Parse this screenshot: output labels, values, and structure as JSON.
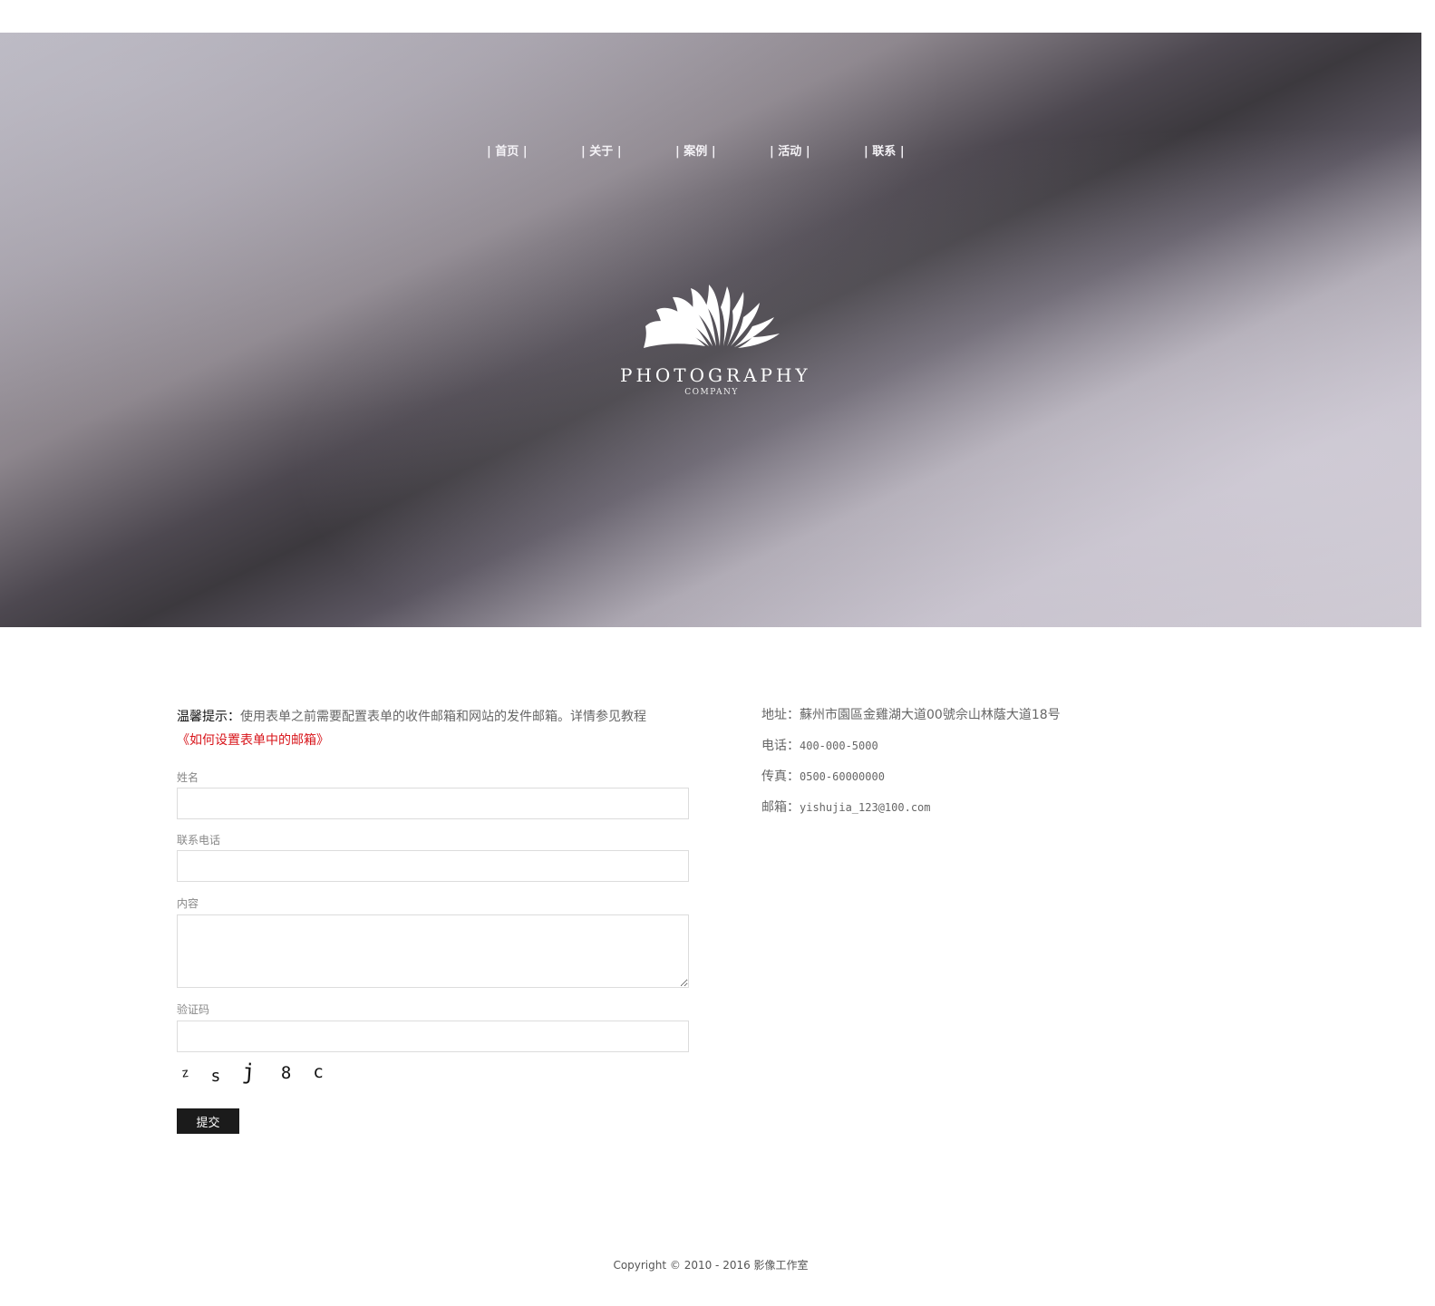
{
  "nav": {
    "items": [
      {
        "label": "首页"
      },
      {
        "label": "关于"
      },
      {
        "label": "案例"
      },
      {
        "label": "活动"
      },
      {
        "label": "联系"
      }
    ],
    "separator": "|"
  },
  "logo": {
    "icon": "shell-fan-icon",
    "title": "PHOTOGRAPHY",
    "subtitle": "COMPANY"
  },
  "notice": {
    "label": "温馨提示：",
    "text": "使用表单之前需要配置表单的收件邮箱和网站的发件邮箱。详情参见教程",
    "link": "《如何设置表单中的邮箱》"
  },
  "form": {
    "name_label": "姓名",
    "name_value": "",
    "phone_label": "联系电话",
    "phone_value": "",
    "content_label": "内容",
    "content_value": "",
    "captcha_label": "验证码",
    "captcha_value": "",
    "captcha_chars": [
      "z",
      "s",
      "j",
      "8",
      "c"
    ],
    "submit_label": "提交"
  },
  "contact": {
    "address_label": "地址：",
    "address": "蘇州市園區金雞湖大道00號佘山林蔭大道18号",
    "phone_label": "电话：",
    "phone": "400-000-5000",
    "fax_label": "传真：",
    "fax": "0500-60000000",
    "email_label": "邮箱：",
    "email": "yishujia_123@100.com"
  },
  "footer": {
    "copyright": "Copyright © 2010 - 2016 影像工作室"
  },
  "colors": {
    "link_red": "#d8141a",
    "button_dark": "#1b1b1b",
    "hero_dark": "#3c393e",
    "hero_light": "#cbc6cf"
  }
}
